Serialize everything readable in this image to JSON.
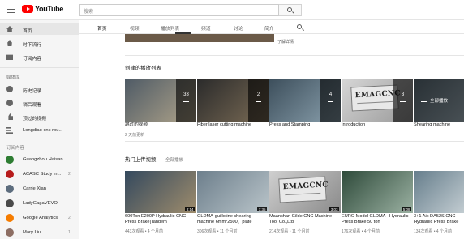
{
  "header": {
    "logo_text": "YouTube",
    "search_placeholder": "搜索"
  },
  "sidebar": {
    "items": [
      {
        "label": "首页",
        "icon": "home-icon"
      },
      {
        "label": "时下流行",
        "icon": "flame-icon"
      },
      {
        "label": "订阅内容",
        "icon": "subscriptions-icon"
      }
    ],
    "library_heading": "媒体库",
    "library_items": [
      {
        "label": "历史记录",
        "icon": "history-icon"
      },
      {
        "label": "稍后观看",
        "icon": "clock-icon"
      },
      {
        "label": "顶过的视频",
        "icon": "thumbs-up-icon"
      },
      {
        "label": "Longdiao cnc rou...",
        "icon": "playlist-icon"
      }
    ],
    "subs_heading": "订阅内容",
    "subs": [
      {
        "label": "Guangzhou Haisan",
        "count": "",
        "color": "#2e7d32"
      },
      {
        "label": "ACASC Study in...",
        "count": "2",
        "color": "#b71c1c"
      },
      {
        "label": "Carrie Xian",
        "count": "",
        "color": "#5d6d7e"
      },
      {
        "label": "LadyGagaVEVO",
        "count": "",
        "color": "#4a4a4a"
      },
      {
        "label": "Google Analytics",
        "count": "2",
        "color": "#f57c00"
      },
      {
        "label": "Mary Liu",
        "count": "1",
        "color": "#8d6e63"
      }
    ]
  },
  "tabs": [
    "首页",
    "视频",
    "播放列表",
    "频道",
    "讨论",
    "简介"
  ],
  "top_snippet": "了解详情",
  "playlists": {
    "title": "创建的播放列表",
    "items": [
      {
        "title": "跳过的视频",
        "meta": "2 天前更新",
        "count": "33",
        "colors": [
          "#4f5b66",
          "#b0a48a"
        ]
      },
      {
        "title": "Fiber laser cutting machine",
        "meta": "",
        "count": "2",
        "colors": [
          "#2b2b2b",
          "#7a6b55"
        ]
      },
      {
        "title": "Press and Stamping",
        "meta": "",
        "count": "4",
        "colors": [
          "#3d4f5c",
          "#8aa0ad"
        ]
      },
      {
        "title": "Introduction",
        "meta": "",
        "count": "3",
        "colors": [
          "#d6d6d6",
          "#9a9a9a"
        ],
        "emag": "EMAGCNC"
      },
      {
        "title": "Shearing machine",
        "meta": "",
        "count": "",
        "colors": [
          "#5b6c77",
          "#9fb0ba"
        ],
        "overlay": "全部播放"
      }
    ]
  },
  "uploads": {
    "title": "热门上传视频",
    "play_all": "全部播放",
    "items": [
      {
        "title": "600Ton E200P Hydraulic CNC Press Brake|Tandem",
        "meta": "443次观看 • 4 个月前",
        "dur": "8:14",
        "colors": [
          "#34495e",
          "#9e8c6c"
        ]
      },
      {
        "title": "GLDMA-guillotine shearing machine 6mm*2500、plate",
        "meta": "306次观看 • 11 个月前",
        "dur": "1:35",
        "colors": [
          "#6d7f8c",
          "#b9c4c9"
        ]
      },
      {
        "title": "Maanshan Gilde CNC Machine Tool Co.,Ltd.",
        "meta": "214次观看 • 11 个月前",
        "dur": "3:03",
        "colors": [
          "#cfcfcf",
          "#8a8a8a"
        ],
        "emag": "EMAGCNC"
      },
      {
        "title": "EURO Model GLDMA - Hydraulic Press Brake 50 ton",
        "meta": "176次观看 • 4 个月前",
        "dur": "5:08",
        "colors": [
          "#2e4a3a",
          "#9bb1a2"
        ]
      },
      {
        "title": "3+1 Aix DA52S CNC Hydraulic Press Brake",
        "meta": "134次观看 • 4 个月前",
        "dur": "",
        "colors": [
          "#667e8c",
          "#c2ccd1"
        ]
      }
    ]
  }
}
